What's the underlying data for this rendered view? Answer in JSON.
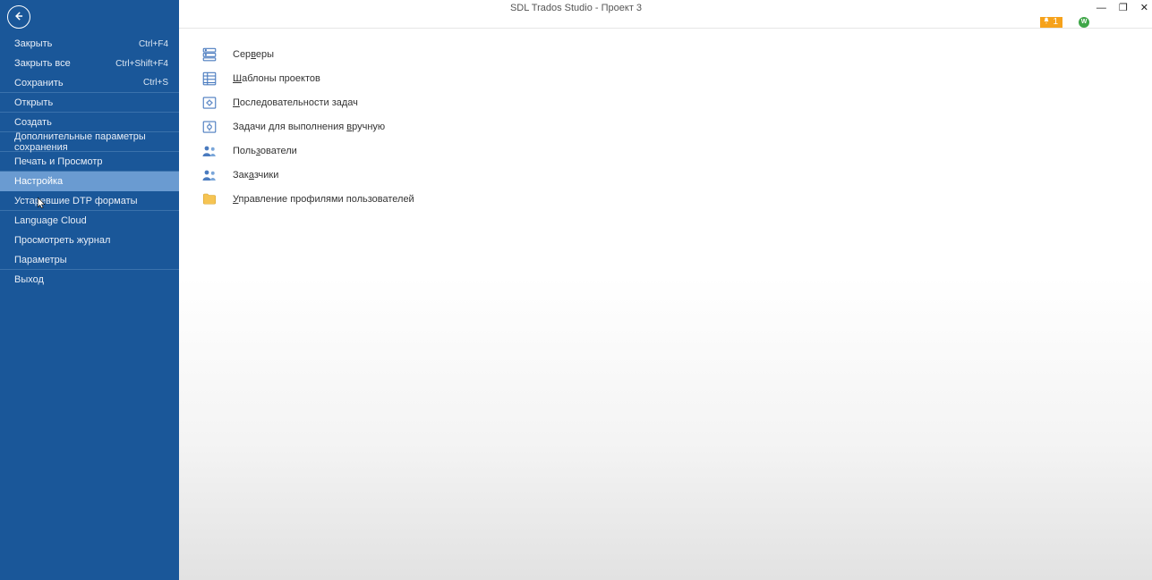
{
  "window": {
    "title": "SDL Trados Studio - Проект 3"
  },
  "notifications": {
    "count": "1",
    "user_initials": "W"
  },
  "sidebar": {
    "back_label": "Назад",
    "items": [
      {
        "label": "Закрыть",
        "shortcut": "Ctrl+F4",
        "sep": false
      },
      {
        "label": "Закрыть все",
        "shortcut": "Ctrl+Shift+F4",
        "sep": false
      },
      {
        "label": "Сохранить",
        "shortcut": "Ctrl+S",
        "sep": true
      },
      {
        "label": "Открыть",
        "shortcut": "",
        "sep": true
      },
      {
        "label": "Создать",
        "shortcut": "",
        "sep": true
      },
      {
        "label": "Дополнительные параметры сохранения",
        "shortcut": "",
        "sep": true
      },
      {
        "label": "Печать и Просмотр",
        "shortcut": "",
        "sep": true
      },
      {
        "label": "Настройка",
        "shortcut": "",
        "sep": false,
        "selected": true
      },
      {
        "label": "Устаревшие DTP форматы",
        "shortcut": "",
        "sep": true
      },
      {
        "label": "Language Cloud",
        "shortcut": "",
        "sep": false
      },
      {
        "label": "Просмотреть журнал",
        "shortcut": "",
        "sep": false
      },
      {
        "label": "Параметры",
        "shortcut": "",
        "sep": true
      },
      {
        "label": "Выход",
        "shortcut": "",
        "sep": false
      }
    ]
  },
  "settings_pane": {
    "items": [
      {
        "icon": "servers",
        "label_pre": "Сер",
        "mn": "в",
        "label_post": "еры"
      },
      {
        "icon": "templates",
        "label_pre": "",
        "mn": "Ш",
        "label_post": "аблоны проектов"
      },
      {
        "icon": "task-seq",
        "label_pre": "",
        "mn": "П",
        "label_post": "оследовательности задач"
      },
      {
        "icon": "manual-tasks",
        "label_pre": "Задачи для выполнения ",
        "mn": "в",
        "label_post": "ручную"
      },
      {
        "icon": "users",
        "label_pre": "Поль",
        "mn": "з",
        "label_post": "ователи"
      },
      {
        "icon": "customers",
        "label_pre": "Зак",
        "mn": "а",
        "label_post": "зчики"
      },
      {
        "icon": "user-profiles",
        "label_pre": "",
        "mn": "У",
        "label_post": "правление профилями пользователей"
      }
    ]
  }
}
